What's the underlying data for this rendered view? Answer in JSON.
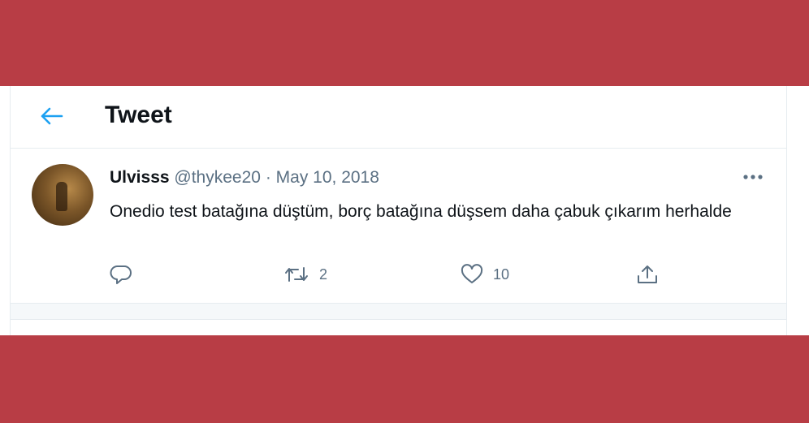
{
  "header": {
    "title": "Tweet",
    "back_icon": "arrow-left-icon",
    "accent": "#1da1f2"
  },
  "tweet": {
    "display_name": "Ulvisss",
    "handle": "@thykee20",
    "separator": "·",
    "date": "May 10, 2018",
    "text": "Onedio test batağına düştüm, borç batağına düşsem daha çabuk çıkarım herhalde",
    "actions": {
      "reply": {
        "icon": "reply-icon",
        "count": ""
      },
      "retweet": {
        "icon": "retweet-icon",
        "count": "2"
      },
      "like": {
        "icon": "heart-icon",
        "count": "10"
      },
      "share": {
        "icon": "share-icon",
        "count": ""
      }
    }
  },
  "colors": {
    "band": "#b83d45",
    "text": "#0f1419",
    "muted": "#5b7083",
    "border": "#e6ecf0"
  }
}
